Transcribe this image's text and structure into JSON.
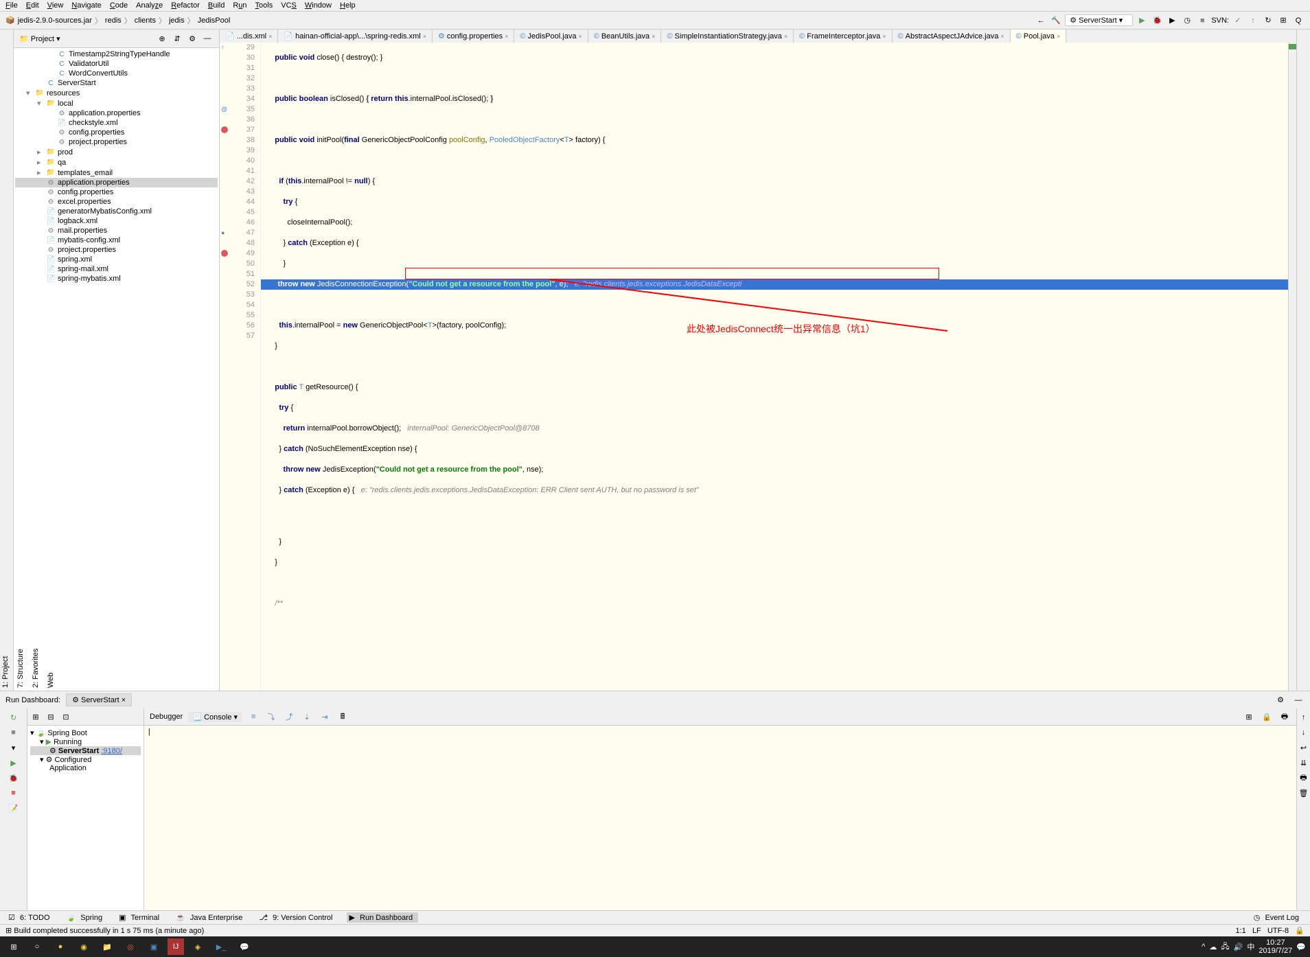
{
  "menu": [
    "File",
    "Edit",
    "View",
    "Navigate",
    "Code",
    "Analyze",
    "Refactor",
    "Build",
    "Run",
    "Tools",
    "VCS",
    "Window",
    "Help"
  ],
  "breadcrumb": [
    "jedis-2.9.0-sources.jar",
    "redis",
    "clients",
    "jedis",
    "JedisPool"
  ],
  "runConfig": "ServerStart",
  "svnLabel": "SVN:",
  "projectLabel": "Project",
  "tree": [
    {
      "d": 3,
      "ic": "C",
      "t": "Timestamp2StringTypeHandle",
      "c": "#4a88c7"
    },
    {
      "d": 3,
      "ic": "C",
      "t": "ValidatorUtil",
      "c": "#4a88c7"
    },
    {
      "d": 3,
      "ic": "C",
      "t": "WordConvertUtils",
      "c": "#4a88c7"
    },
    {
      "d": 2,
      "ic": "C",
      "t": "ServerStart",
      "c": "#4a88c7"
    },
    {
      "d": 1,
      "tw": "▾",
      "ic": "📁",
      "t": "resources"
    },
    {
      "d": 2,
      "tw": "▾",
      "ic": "📁",
      "t": "local"
    },
    {
      "d": 3,
      "ic": "⚙",
      "t": "application.properties"
    },
    {
      "d": 3,
      "ic": "📄",
      "t": "checkstyle.xml"
    },
    {
      "d": 3,
      "ic": "⚙",
      "t": "config.properties"
    },
    {
      "d": 3,
      "ic": "⚙",
      "t": "project.properties"
    },
    {
      "d": 2,
      "tw": "▸",
      "ic": "📁",
      "t": "prod"
    },
    {
      "d": 2,
      "tw": "▸",
      "ic": "📁",
      "t": "qa"
    },
    {
      "d": 2,
      "tw": "▸",
      "ic": "📁",
      "t": "templates_email"
    },
    {
      "d": 2,
      "ic": "⚙",
      "t": "application.properties",
      "sel": true
    },
    {
      "d": 2,
      "ic": "⚙",
      "t": "config.properties"
    },
    {
      "d": 2,
      "ic": "⚙",
      "t": "excel.properties"
    },
    {
      "d": 2,
      "ic": "📄",
      "t": "generatorMybatisConfig.xml"
    },
    {
      "d": 2,
      "ic": "📄",
      "t": "logback.xml"
    },
    {
      "d": 2,
      "ic": "⚙",
      "t": "mail.properties"
    },
    {
      "d": 2,
      "ic": "📄",
      "t": "mybatis-config.xml"
    },
    {
      "d": 2,
      "ic": "⚙",
      "t": "project.properties"
    },
    {
      "d": 2,
      "ic": "📄",
      "t": "spring.xml"
    },
    {
      "d": 2,
      "ic": "📄",
      "t": "spring-mail.xml"
    },
    {
      "d": 2,
      "ic": "📄",
      "t": "spring-mybatis.xml"
    }
  ],
  "tabs": [
    "...dis.xml",
    "hainan-official-app\\...\\spring-redis.xml",
    "config.properties",
    "JedisPool.java",
    "BeanUtils.java",
    "SimpleInstantiationStrategy.java",
    "FrameInterceptor.java",
    "AbstractAspectJAdvice.java",
    "Pool.java"
  ],
  "activeTab": 8,
  "lines": [
    29,
    30,
    31,
    32,
    33,
    34,
    35,
    36,
    37,
    38,
    39,
    40,
    41,
    42,
    43,
    44,
    45,
    46,
    47,
    48,
    49,
    50,
    51,
    52,
    53,
    54,
    55,
    56,
    57
  ],
  "code": {
    "l29": "    public void close() { destroy(); }",
    "l31a": "    public boolean isClosed() ",
    "l31b": "{",
    "l31c": " return this.internalPool.isClosed(); ",
    "l31d": "}",
    "l33": "    public void initPool(final GenericObjectPoolConfig poolConfig, PooledObjectFactory<T> factory) {",
    "l35": "      if (this.internalPool != null) {",
    "l36": "        try {",
    "l37": "          closeInternalPool();",
    "l38": "        } catch (Exception e) {",
    "l39": "        }",
    "l40": "      }",
    "l42": "      this.internalPool = new GenericObjectPool<T>(factory, poolConfig);",
    "l43": "    }",
    "l45": "    public T getResource() {",
    "l46": "      try {",
    "l47": "        return internalPool.borrowObject();   internalPool: GenericObjectPool@8708",
    "l48": "      } catch (NoSuchElementException nse) {",
    "l49": "        throw new JedisException(\"Could not get a resource from the pool\", nse);",
    "l50a": "      } catch (Exception e) {",
    "l50b": "   e: \"redis.clients.jedis.exceptions.JedisDataException: ERR Client sent AUTH, but no password is set\"",
    "l51a": "        throw new JedisConnectionException(",
    "l51b": "\"Could not get a resource from the pool\"",
    "l51c": ", e);",
    "l51d": "   e: \"redis.clients.jedis.exceptions.JedisDataExcepti",
    "l52": "      }",
    "l53": "    }",
    "l55": "    /**"
  },
  "annotation": "此处被JedisConnect统一出异常信息（坑1）",
  "runDash": {
    "title": "Run Dashboard:",
    "tab": "ServerStart",
    "debugger": "Debugger",
    "console": "Console",
    "springBoot": "Spring Boot",
    "running": "Running",
    "serverStart": "ServerStart",
    "port": ":9180/",
    "configured": "Configured",
    "application": "Application"
  },
  "bottomTabs": [
    "6: TODO",
    "Spring",
    "Terminal",
    "Java Enterprise",
    "9: Version Control",
    "Run Dashboard"
  ],
  "eventLog": "Event Log",
  "status": {
    "msg": "Build completed successfully in 1 s 75 ms (a minute ago)",
    "pos": "1:1",
    "le": "LF",
    "enc": "UTF-8"
  },
  "taskbar": {
    "time": "10:27",
    "date": "2019/7/27"
  }
}
